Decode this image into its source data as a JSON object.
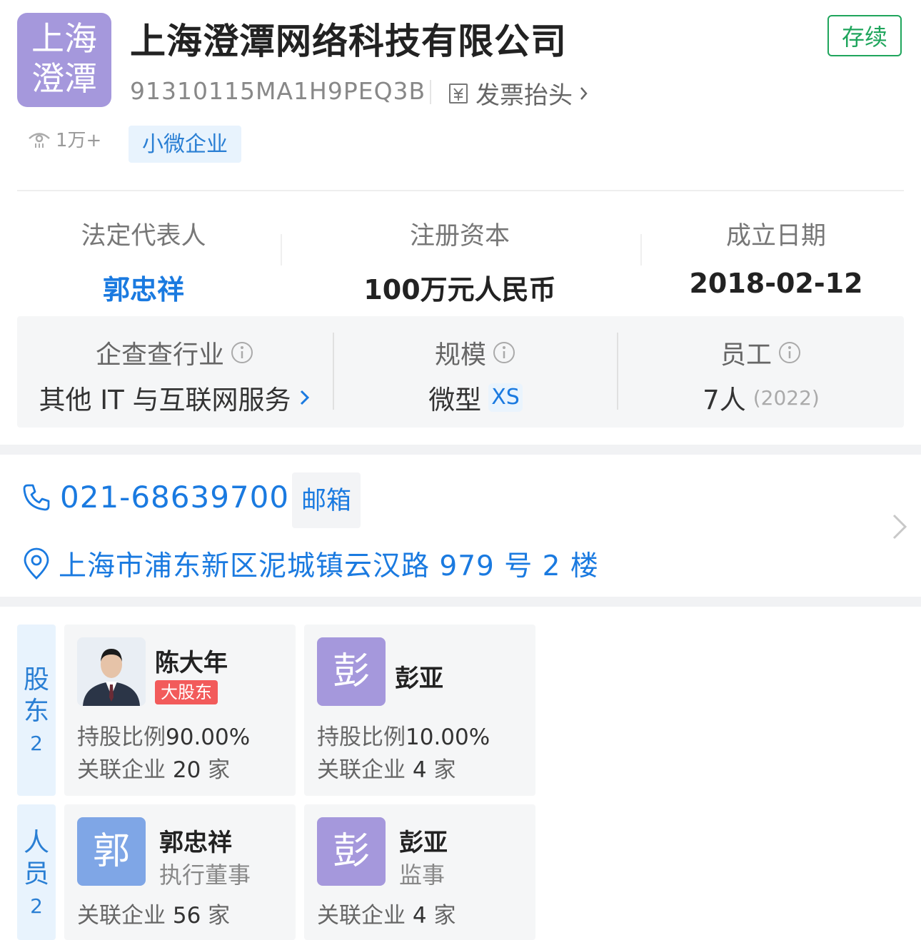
{
  "company": {
    "logo_text_line1": "上海",
    "logo_text_line2": "澄潭",
    "name": "上海澄潭网络科技有限公司",
    "status": "存续",
    "credit_code": "91310115MA1H9PEQ3B",
    "invoice_label": "发票抬头",
    "views": "1万+",
    "tag": "小微企业"
  },
  "key_info": {
    "legal_rep_label": "法定代表人",
    "legal_rep_value": "郭忠祥",
    "capital_label": "注册资本",
    "capital_value": "100万元人民币",
    "founded_label": "成立日期",
    "founded_value": "2018-02-12"
  },
  "meta": {
    "industry_label": "企查查行业",
    "industry_value": "其他 IT 与互联网服务",
    "scale_label": "规模",
    "scale_value": "微型",
    "scale_badge": "XS",
    "employees_label": "员工",
    "employees_value": "7人",
    "employees_year": "(2022)"
  },
  "contact": {
    "phone": "021-68639700",
    "email_label": "邮箱",
    "address": "上海市浦东新区泥城镇云汉路 979 号 2 楼"
  },
  "shareholders": {
    "tab_label_1": "股",
    "tab_label_2": "东",
    "count": "2",
    "items": [
      {
        "name": "陈大年",
        "badge": "大股东",
        "ratio_label": "持股比例",
        "ratio": "90.00%",
        "related_label": "关联企业",
        "related_count": "20",
        "related_unit": "家"
      },
      {
        "avatar": "彭",
        "name": "彭亚",
        "ratio_label": "持股比例",
        "ratio": "10.00%",
        "related_label": "关联企业",
        "related_count": "4",
        "related_unit": "家"
      }
    ]
  },
  "staff": {
    "tab_label_1": "人",
    "tab_label_2": "员",
    "count": "2",
    "items": [
      {
        "avatar": "郭",
        "name": "郭忠祥",
        "role": "执行董事",
        "related_label": "关联企业",
        "related_count": "56",
        "related_unit": "家"
      },
      {
        "avatar": "彭",
        "name": "彭亚",
        "role": "监事",
        "related_label": "关联企业",
        "related_count": "4",
        "related_unit": "家"
      }
    ]
  },
  "colors": {
    "accent_blue": "#1a7ae0",
    "status_green": "#1fa55c",
    "logo_purple": "#a598dc",
    "badge_red": "#f25b5b"
  },
  "icons": [
    "eye-icon",
    "invoice-icon",
    "chevron-right-icon",
    "info-icon",
    "phone-icon",
    "location-icon"
  ]
}
